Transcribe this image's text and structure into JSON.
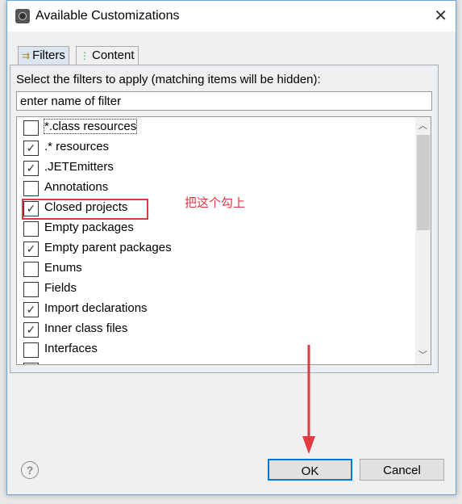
{
  "window": {
    "title": "Available Customizations",
    "close_icon": "close-icon"
  },
  "tabs": [
    {
      "label": "Filters",
      "icon": "filter-icon",
      "active": true
    },
    {
      "label": "Content",
      "icon": "tree-icon",
      "active": false
    }
  ],
  "prompt": "Select the filters to apply (matching items will be hidden):",
  "filter_input": {
    "value": "enter name of filter"
  },
  "filters": [
    {
      "label": "*.class resources",
      "checked": false
    },
    {
      "label": ".* resources",
      "checked": true
    },
    {
      "label": ".JETEmitters",
      "checked": true
    },
    {
      "label": "Annotations",
      "checked": false
    },
    {
      "label": "Closed projects",
      "checked": true
    },
    {
      "label": "Empty packages",
      "checked": false
    },
    {
      "label": "Empty parent packages",
      "checked": true
    },
    {
      "label": "Enums",
      "checked": false
    },
    {
      "label": "Fields",
      "checked": false
    },
    {
      "label": "Import declarations",
      "checked": true
    },
    {
      "label": "Inner class files",
      "checked": true
    },
    {
      "label": "Interfaces",
      "checked": false
    },
    {
      "label": "",
      "checked": true
    }
  ],
  "annotation": {
    "note": "把这个勾上",
    "color": "#e03a40"
  },
  "buttons": {
    "ok": "OK",
    "cancel": "Cancel",
    "help_icon": "help-icon"
  },
  "colors": {
    "accent": "#0078d7"
  }
}
